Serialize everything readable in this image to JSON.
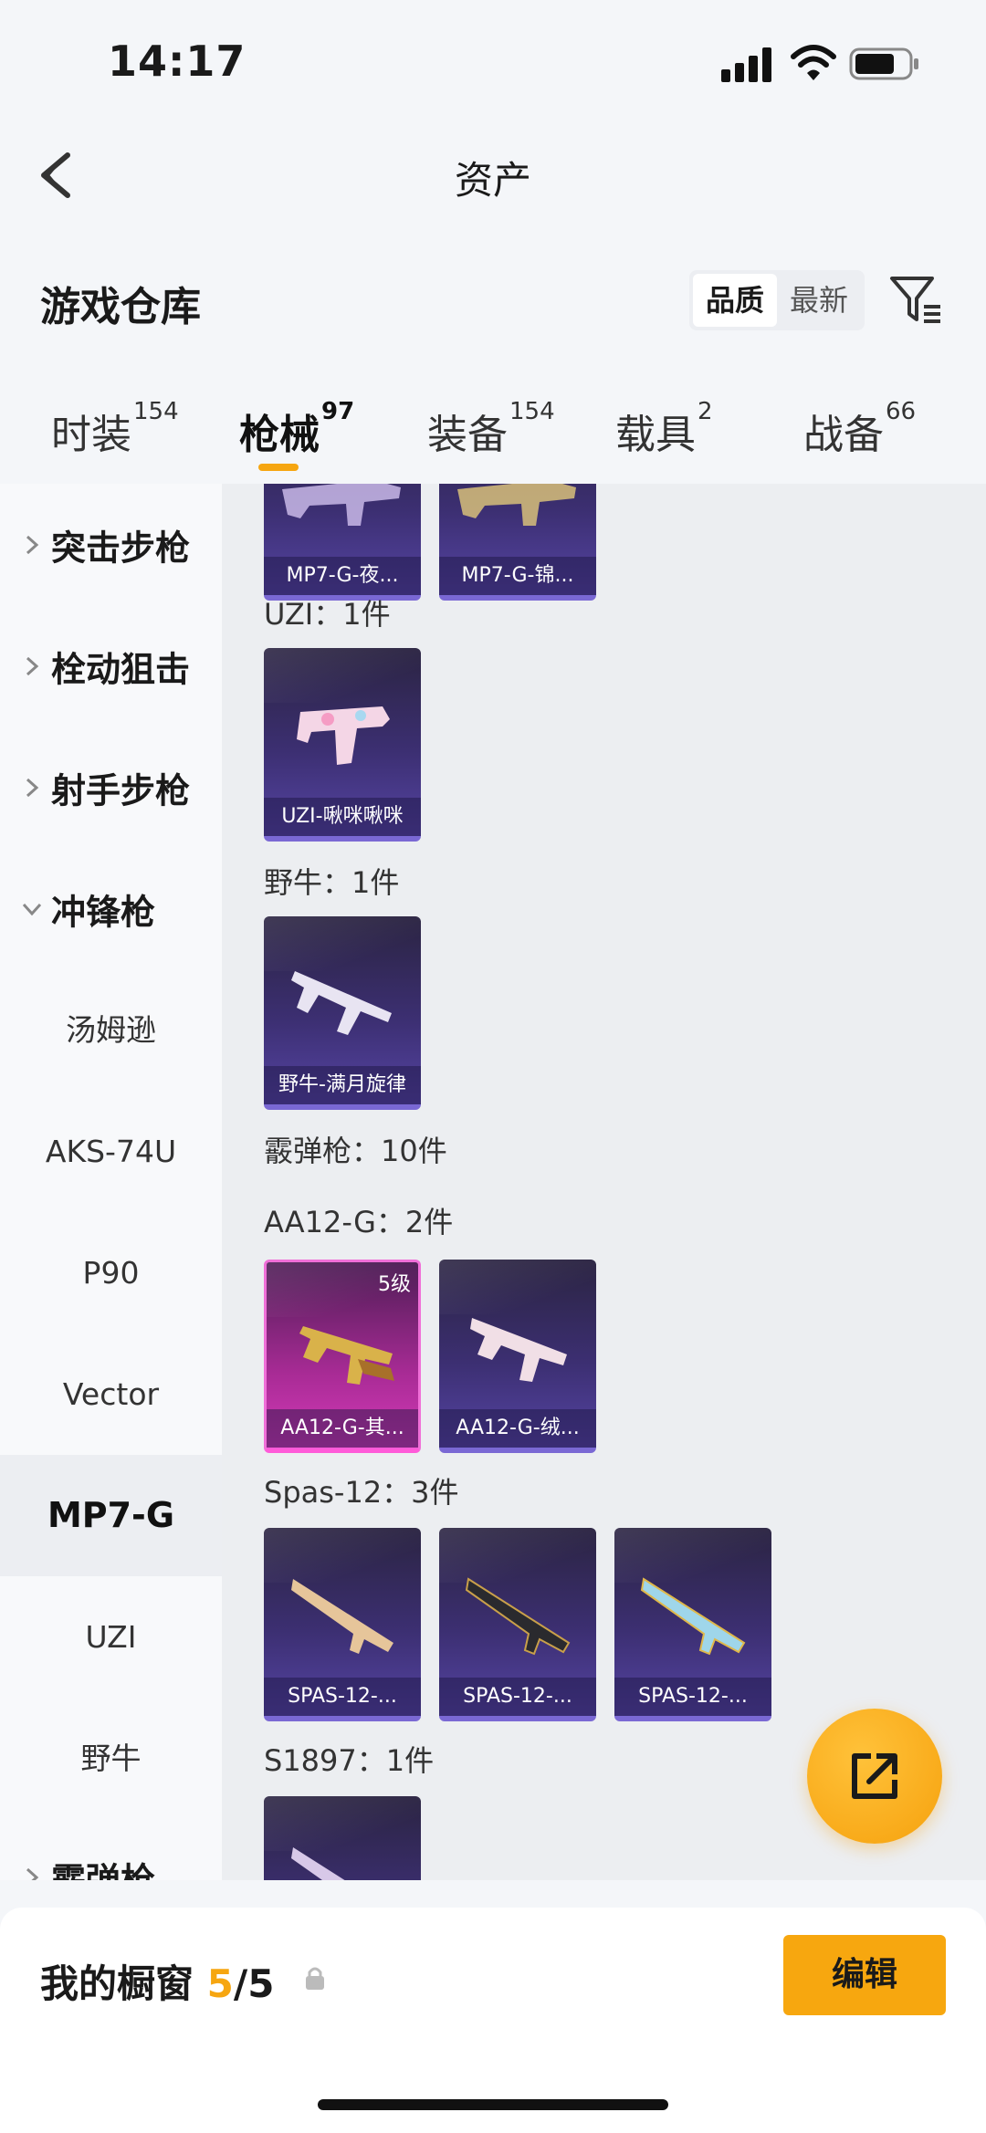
{
  "status": {
    "time": "14:17"
  },
  "nav": {
    "title": "资产"
  },
  "warehouse": {
    "title": "游戏仓库",
    "sort": [
      "品质",
      "最新"
    ]
  },
  "tabs": [
    {
      "label": "时装",
      "count": "154"
    },
    {
      "label": "枪械",
      "count": "97"
    },
    {
      "label": "装备",
      "count": "154"
    },
    {
      "label": "载具",
      "count": "2"
    },
    {
      "label": "战备",
      "count": "66"
    }
  ],
  "sidebar": {
    "categories": [
      "突击步枪",
      "栓动狙击",
      "射手步枪",
      "冲锋枪"
    ],
    "subitems": [
      "汤姆逊",
      "AKS-74U",
      "P90",
      "Vector",
      "MP7-G",
      "UZI",
      "野牛"
    ],
    "bottom_category": "霰弹枪"
  },
  "content": {
    "mp7_cards": [
      "MP7-G-夜...",
      "MP7-G-锦..."
    ],
    "uzi_heading": "UZI：1件",
    "uzi_cards": [
      "UZI-啾咪啾咪"
    ],
    "bizon_heading": "野牛：1件",
    "bizon_cards": [
      "野牛-满月旋律"
    ],
    "shotgun_heading": "霰弹枪：10件",
    "aa12_heading": "AA12-G：2件",
    "aa12_cards": [
      "AA12-G-其...",
      "AA12-G-绒..."
    ],
    "aa12_level": "5级",
    "spas_heading": "Spas-12：3件",
    "spas_cards": [
      "SPAS-12-...",
      "SPAS-12-...",
      "SPAS-12-..."
    ],
    "s1897_heading": "S1897：1件"
  },
  "bottom": {
    "label": "我的橱窗",
    "count": "5",
    "total": "/5",
    "edit": "编辑"
  },
  "colors": {
    "accent": "#f6a611",
    "card": "#3c2f72",
    "card_gold": "#d43ab8"
  }
}
